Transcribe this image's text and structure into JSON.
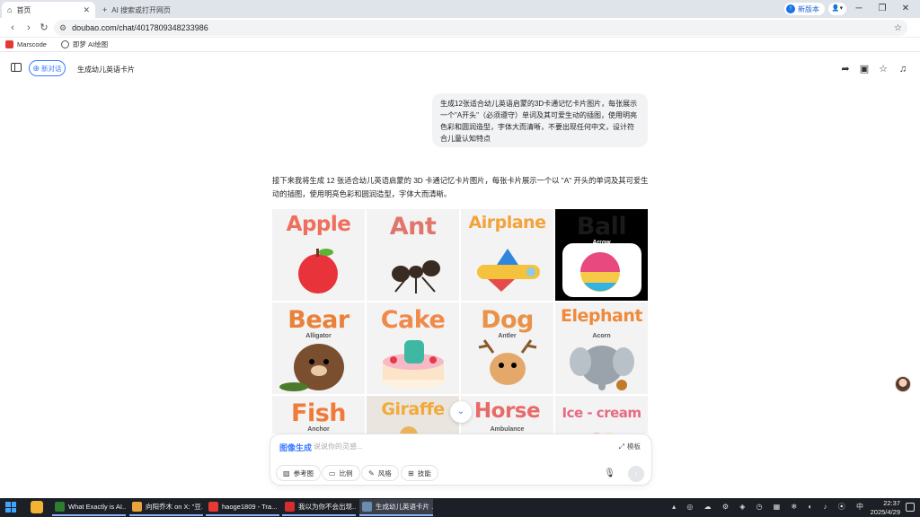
{
  "browser": {
    "tabs": [
      {
        "label": "首页",
        "active": true
      },
      {
        "label": "AI 搜索或打开网页",
        "active": false
      }
    ],
    "new_version": "新版本",
    "url": "doubao.com/chat/4017809348233986",
    "bookmarks": [
      "Marscode",
      "即梦 AI绘图"
    ]
  },
  "header": {
    "new_chat": "新对话",
    "title": "生成幼儿英语卡片"
  },
  "conversation": {
    "user_prompt": "生成12张适合幼儿英语启蒙的3D卡通记忆卡片图片，每张展示一个\"A开头\"（必须遵守）单词及其可爱生动的插图，使用明亮色彩和圆润造型，字体大而清晰，不要出现任何中文，设计符合儿童认知特点",
    "reply": "接下来我将生成 12 张适合幼儿英语启蒙的 3D 卡通记忆卡片图片，每张卡片展示一个以 \"A\" 开头的单词及其可爱生动的插图，使用明亮色彩和圆润造型，字体大而清晰。"
  },
  "cards": [
    {
      "word": "Apple",
      "sub": "",
      "color": "#ef6f5e"
    },
    {
      "word": "Ant",
      "sub": "",
      "color": "#e0766b"
    },
    {
      "word": "Airplane",
      "sub": "",
      "color": "#f3a33c"
    },
    {
      "word": "Ball",
      "sub": "Arrow",
      "color": "#1a1a1a"
    },
    {
      "word": "Bear",
      "sub": "Alligator",
      "color": "#e9813a"
    },
    {
      "word": "Cake",
      "sub": "",
      "color": "#f08a4b"
    },
    {
      "word": "Dog",
      "sub": "Antler",
      "color": "#e9934a"
    },
    {
      "word": "Elephant",
      "sub": "Acorn",
      "color": "#ef8a3c"
    },
    {
      "word": "Fish",
      "sub": "Anchor",
      "color": "#f07a3a"
    },
    {
      "word": "Giraffe",
      "sub": "",
      "color": "#f2a93b"
    },
    {
      "word": "Horse",
      "sub": "Ambulance",
      "color": "#e96a6a"
    },
    {
      "word": "Ice - cream",
      "sub": "",
      "color": "#e66b82"
    }
  ],
  "composer": {
    "mode": "图像生成",
    "placeholder": "说说你的灵感...",
    "template": "模板",
    "chips": [
      "参考图",
      "比例",
      "风格",
      "技能"
    ]
  },
  "taskbar": {
    "tasks": [
      {
        "label": "What Exactly is AI...",
        "color": "#2e7d32"
      },
      {
        "label": "向阳乔木 on X: \"豆...",
        "color": "#e8a33c"
      },
      {
        "label": "haoge1809 - Tra...",
        "color": "#e53935"
      },
      {
        "label": "我以为你不会出现...",
        "color": "#d32f2f"
      },
      {
        "label": "生成幼儿英语卡片 ...",
        "color": "#6a8caf"
      }
    ],
    "ime": "中",
    "time": "22:37",
    "date": "2025/4/29"
  }
}
